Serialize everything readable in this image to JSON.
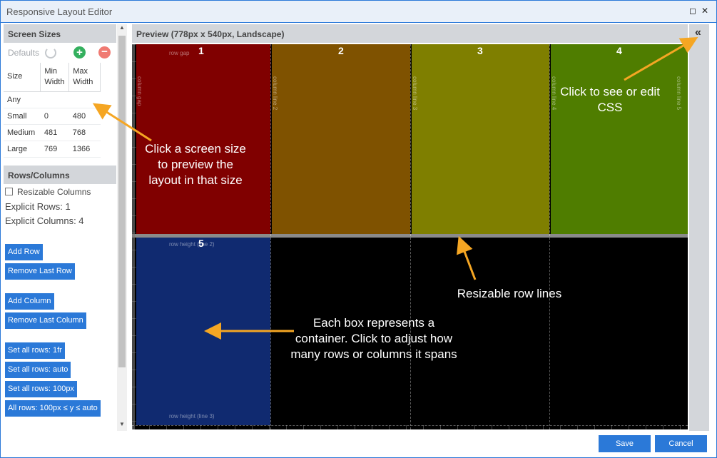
{
  "window": {
    "title": "Responsive Layout Editor",
    "restore_glyph": "◻",
    "close_glyph": "✕"
  },
  "sidebar": {
    "screen_sizes_header": "Screen Sizes",
    "defaults_label": "Defaults",
    "add_glyph": "+",
    "remove_glyph": "−",
    "table_headers": [
      "Size",
      "Min Width",
      "Max Width"
    ],
    "sizes": [
      {
        "name": "Any",
        "min": "",
        "max": ""
      },
      {
        "name": "Small",
        "min": "0",
        "max": "480"
      },
      {
        "name": "Medium",
        "min": "481",
        "max": "768"
      },
      {
        "name": "Large",
        "min": "769",
        "max": "1366"
      }
    ],
    "rows_columns_header": "Rows/Columns",
    "resizable_columns_label": "Resizable Columns",
    "explicit_rows": "Explicit Rows: 1",
    "explicit_columns": "Explicit Columns: 4",
    "buttons": {
      "add_row": "Add Row",
      "remove_last_row": "Remove Last Row",
      "add_column": "Add Column",
      "remove_last_column": "Remove Last Column",
      "set_rows_1fr": "Set all rows: 1fr",
      "set_rows_auto": "Set all rows: auto",
      "set_rows_100px": "Set all rows: 100px",
      "all_rows_minmax": "All rows: 100px ≤ y ≤ auto"
    }
  },
  "preview": {
    "header": "Preview (778px x 540px, Landscape)",
    "cell_numbers": [
      "1",
      "2",
      "3",
      "4",
      "5"
    ],
    "labels": {
      "row_gap": "row gap",
      "column_gap": "column gap",
      "column_line_2": "column line 2",
      "column_line_3": "column line 3",
      "column_line_4": "column line 4",
      "column_line_5": "column line 5",
      "row_height_line_2": "row height (line 2)",
      "row_height_line_3": "row height (line 3)"
    },
    "colors": {
      "cell1": "#800000",
      "cell2": "#7f5200",
      "cell3": "#7f7f00",
      "cell4": "#4f7d00",
      "cell5": "#102a70"
    },
    "collapse_glyph": "«"
  },
  "annotations": {
    "css": "Click to see or edit CSS",
    "screen_size": "Click a screen size to preview the layout in that size",
    "row_lines": "Resizable row lines",
    "container": "Each box represents a container. Click to adjust how many rows or columns it spans"
  },
  "footer": {
    "save": "Save",
    "cancel": "Cancel"
  },
  "accent_color": "#2b79d8",
  "annotation_arrow_color": "#f5a623"
}
